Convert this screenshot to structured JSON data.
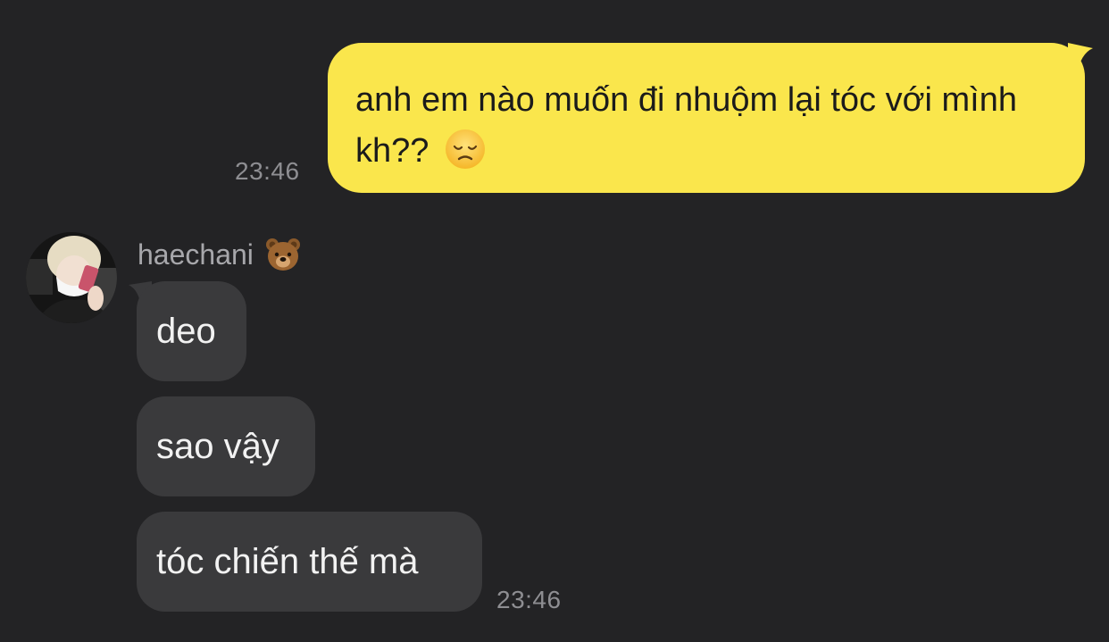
{
  "outgoing": {
    "text": "anh em nào muốn đi nhuộm lại tóc với mình kh??",
    "emoji": "😞",
    "time": "23:46",
    "bubble_color": "#fae64c"
  },
  "sender": {
    "name": "haechani",
    "name_emoji": "🐻"
  },
  "incoming": {
    "messages": [
      {
        "text": "deo"
      },
      {
        "text": "sao vậy"
      },
      {
        "text": "tóc chiến thế mà"
      }
    ],
    "time": "23:46",
    "bubble_color": "#3a3a3c"
  },
  "icons": {
    "avatar": "avatar-photo",
    "sad": "disappointed-face-icon",
    "bear": "bear-face-icon"
  },
  "colors": {
    "background": "#232325",
    "timestamp": "#8e8e92"
  }
}
